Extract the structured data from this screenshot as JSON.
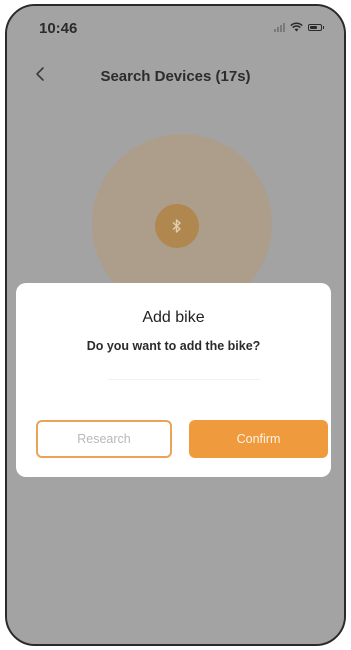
{
  "status_bar": {
    "time": "10:46",
    "icons": [
      "signal-icon",
      "wifi-icon",
      "battery-icon"
    ]
  },
  "nav": {
    "back_icon": "chevron-left-icon",
    "title": "Search Devices (17s)"
  },
  "scan": {
    "icon": "bluetooth-icon"
  },
  "dialog": {
    "title": "Add bike",
    "message": "Do you want to add the bike?",
    "research_label": "Research",
    "confirm_label": "Confirm"
  },
  "colors": {
    "accent": "#f09a3e",
    "research_border": "#e9a459",
    "overlay": "#a3a3a3",
    "dialog_bg": "#ffffff"
  }
}
